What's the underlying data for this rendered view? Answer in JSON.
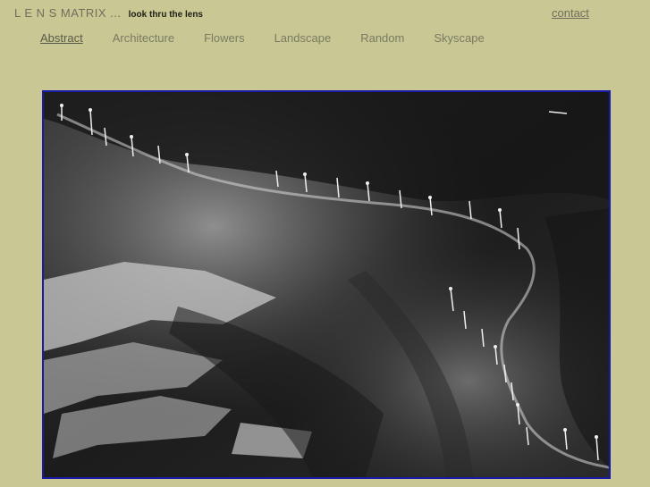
{
  "header": {
    "title": "L E N S MATRIX ...",
    "tagline": "look thru the lens",
    "contact_label": "contact"
  },
  "nav": {
    "items": [
      {
        "label": "Abstract",
        "active": true
      },
      {
        "label": "Architecture",
        "active": false
      },
      {
        "label": "Flowers",
        "active": false
      },
      {
        "label": "Landscape",
        "active": false
      },
      {
        "label": "Random",
        "active": false
      },
      {
        "label": "Skyscape",
        "active": false
      }
    ]
  },
  "colors": {
    "background": "#c9c894",
    "frame_border": "#1a1aa8"
  }
}
